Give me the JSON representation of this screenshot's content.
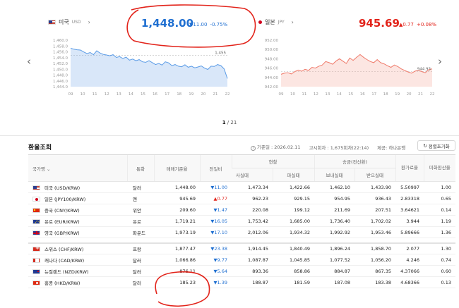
{
  "usd_panel": {
    "country": "미국",
    "code": "USD",
    "value": "1,448.00",
    "change": "▼11.00",
    "change_pct": "-0.75%",
    "last_label": "1,455",
    "y_ticks": [
      "1,460.0",
      "1,458.0",
      "1,456.0",
      "1,454.0",
      "1,452.0",
      "1,450.0",
      "1,448.0",
      "1,446.0",
      "1,444.0"
    ],
    "x_ticks": [
      "09",
      "10",
      "11",
      "12",
      "13",
      "14",
      "15",
      "16",
      "17",
      "18",
      "19",
      "20",
      "21",
      "22"
    ]
  },
  "jpy_panel": {
    "country": "일본",
    "code": "JPY",
    "value": "945.69",
    "change": "▲0.77",
    "change_pct": "+0.08%",
    "last_label": "944.93",
    "y_ticks": [
      "952.00",
      "950.00",
      "948.00",
      "946.00",
      "944.00",
      "942.00"
    ],
    "x_ticks": [
      "09",
      "10",
      "11",
      "12",
      "13",
      "14",
      "15",
      "16",
      "17",
      "18",
      "19",
      "20",
      "21",
      "22"
    ]
  },
  "pager": {
    "current": "1",
    "total": "/ 21"
  },
  "section": {
    "title": "환율조회",
    "base_time": "기준일 : 2026.02.11",
    "notice_count": "고시회차 : 1,675회차(22:14)",
    "provider": "제공: 하나은행",
    "reset_label": "정렬초기화"
  },
  "table": {
    "headers": {
      "country": "국가명",
      "currency": "통화",
      "base_rate": "매매기준율",
      "prev_day": "전일비",
      "cash": "현찰",
      "remit": "송금(전신환)",
      "usd_ratio": "환가료율",
      "usd_conv": "미화환산율",
      "buy_cash": "사실때",
      "sell_cash": "파실때",
      "send": "보내실때",
      "receive": "받으실때"
    },
    "rows": [
      {
        "flag": "us",
        "name": "미국 (USD/KRW)",
        "unit": "달러",
        "rate": "1,448.00",
        "dir": "dn",
        "chg": "▼11.00",
        "buy": "1,473.34",
        "sell": "1,422.66",
        "send": "1,462.10",
        "recv": "1,433.90",
        "ratio": "5.50997",
        "conv": "1.00"
      },
      {
        "flag": "jp",
        "name": "일본 (JPY100/KRW)",
        "unit": "엔",
        "rate": "945.69",
        "dir": "up",
        "chg": "▲0.77",
        "buy": "962.23",
        "sell": "929.15",
        "send": "954.95",
        "recv": "936.43",
        "ratio": "2.83318",
        "conv": "0.65"
      },
      {
        "flag": "cn",
        "name": "중국 (CNY/KRW)",
        "unit": "위안",
        "rate": "209.60",
        "dir": "dn",
        "chg": "▼1.47",
        "buy": "220.08",
        "sell": "199.12",
        "send": "211.69",
        "recv": "207.51",
        "ratio": "3.64621",
        "conv": "0.14"
      },
      {
        "flag": "eu",
        "name": "유로 (EUR/KRW)",
        "unit": "유로",
        "rate": "1,719.21",
        "dir": "dn",
        "chg": "▼16.05",
        "buy": "1,753.42",
        "sell": "1,685.00",
        "send": "1,736.40",
        "recv": "1,702.02",
        "ratio": "3.944",
        "conv": "1.19"
      },
      {
        "flag": "gb",
        "name": "영국 (GBP/KRW)",
        "unit": "파운드",
        "rate": "1,973.19",
        "dir": "dn",
        "chg": "▼17.10",
        "buy": "2,012.06",
        "sell": "1,934.32",
        "send": "1,992.92",
        "recv": "1,953.46",
        "ratio": "5.89666",
        "conv": "1.36"
      },
      {
        "flag": "ch",
        "name": "스위스 (CHF/KRW)",
        "unit": "프랑",
        "rate": "1,877.47",
        "dir": "dn",
        "chg": "▼23.38",
        "buy": "1,914.45",
        "sell": "1,840.49",
        "send": "1,896.24",
        "recv": "1,858.70",
        "ratio": "2.077",
        "conv": "1.30"
      },
      {
        "flag": "ca",
        "name": "캐나다 (CAD/KRW)",
        "unit": "달러",
        "rate": "1,066.86",
        "dir": "dn",
        "chg": "▼9.77",
        "buy": "1,087.87",
        "sell": "1,045.85",
        "send": "1,077.52",
        "recv": "1,056.20",
        "ratio": "4.246",
        "conv": "0.74"
      },
      {
        "flag": "nz",
        "name": "뉴질랜드 (NZD/KRW)",
        "unit": "달러",
        "rate": "876.11",
        "dir": "dn",
        "chg": "▼5.64",
        "buy": "893.36",
        "sell": "858.86",
        "send": "884.87",
        "recv": "867.35",
        "ratio": "4.37066",
        "conv": "0.60"
      },
      {
        "flag": "hk",
        "name": "홍콩 (HKD/KRW)",
        "unit": "달러",
        "rate": "185.23",
        "dir": "dn",
        "chg": "▼1.39",
        "buy": "188.87",
        "sell": "181.59",
        "send": "187.08",
        "recv": "183.38",
        "ratio": "4.68366",
        "conv": "0.13"
      }
    ]
  },
  "colors": {
    "down": "#1f6fd1",
    "up": "#e2231a",
    "annotation": "#e2231a"
  },
  "icons": [
    "chevron-right-icon",
    "chevron-left-icon",
    "info-icon",
    "refresh-icon",
    "sort-down-icon"
  ],
  "chart_data": [
    {
      "type": "area",
      "series": [
        {
          "values": [
            1457.6,
            1457.2,
            1457.0,
            1456.9,
            1456.2,
            1455.6,
            1456.0,
            1455.2,
            1456.6,
            1455.8,
            1455.3,
            1455.1,
            1454.8,
            1455.2,
            1454.2,
            1454.5,
            1453.8,
            1454.3,
            1453.2,
            1453.6,
            1453.0,
            1453.4,
            1452.6,
            1452.4,
            1453.0,
            1452.3,
            1451.6,
            1452.0,
            1451.4,
            1452.6,
            1452.2,
            1451.2,
            1451.6,
            1451.0,
            1450.8,
            1451.5,
            1450.6,
            1451.0,
            1450.4,
            1450.7,
            1451.1,
            1450.3,
            1449.8,
            1451.0,
            1450.9,
            1451.6,
            1451.2,
            1450.0,
            1446.5
          ]
        }
      ],
      "ylim": [
        1443.5,
        1460.5
      ],
      "reference_line": 1455
    },
    {
      "type": "area",
      "series": [
        {
          "values": [
            944.2,
            944.5,
            944.6,
            944.3,
            944.9,
            945.3,
            945.0,
            945.5,
            945.2,
            946.0,
            945.8,
            946.3,
            946.6,
            947.5,
            947.2,
            946.8,
            947.6,
            948.2,
            947.6,
            947.0,
            948.4,
            947.8,
            948.6,
            949.3,
            948.6,
            948.0,
            947.5,
            947.2,
            948.0,
            947.2,
            946.9,
            946.4,
            946.0,
            946.6,
            946.2,
            945.6,
            945.2,
            944.8,
            944.5,
            945.0,
            945.3,
            944.9,
            944.6,
            945.4,
            945.6
          ]
        }
      ],
      "ylim": [
        941.0,
        953.0
      ],
      "reference_line": 944.93
    }
  ]
}
